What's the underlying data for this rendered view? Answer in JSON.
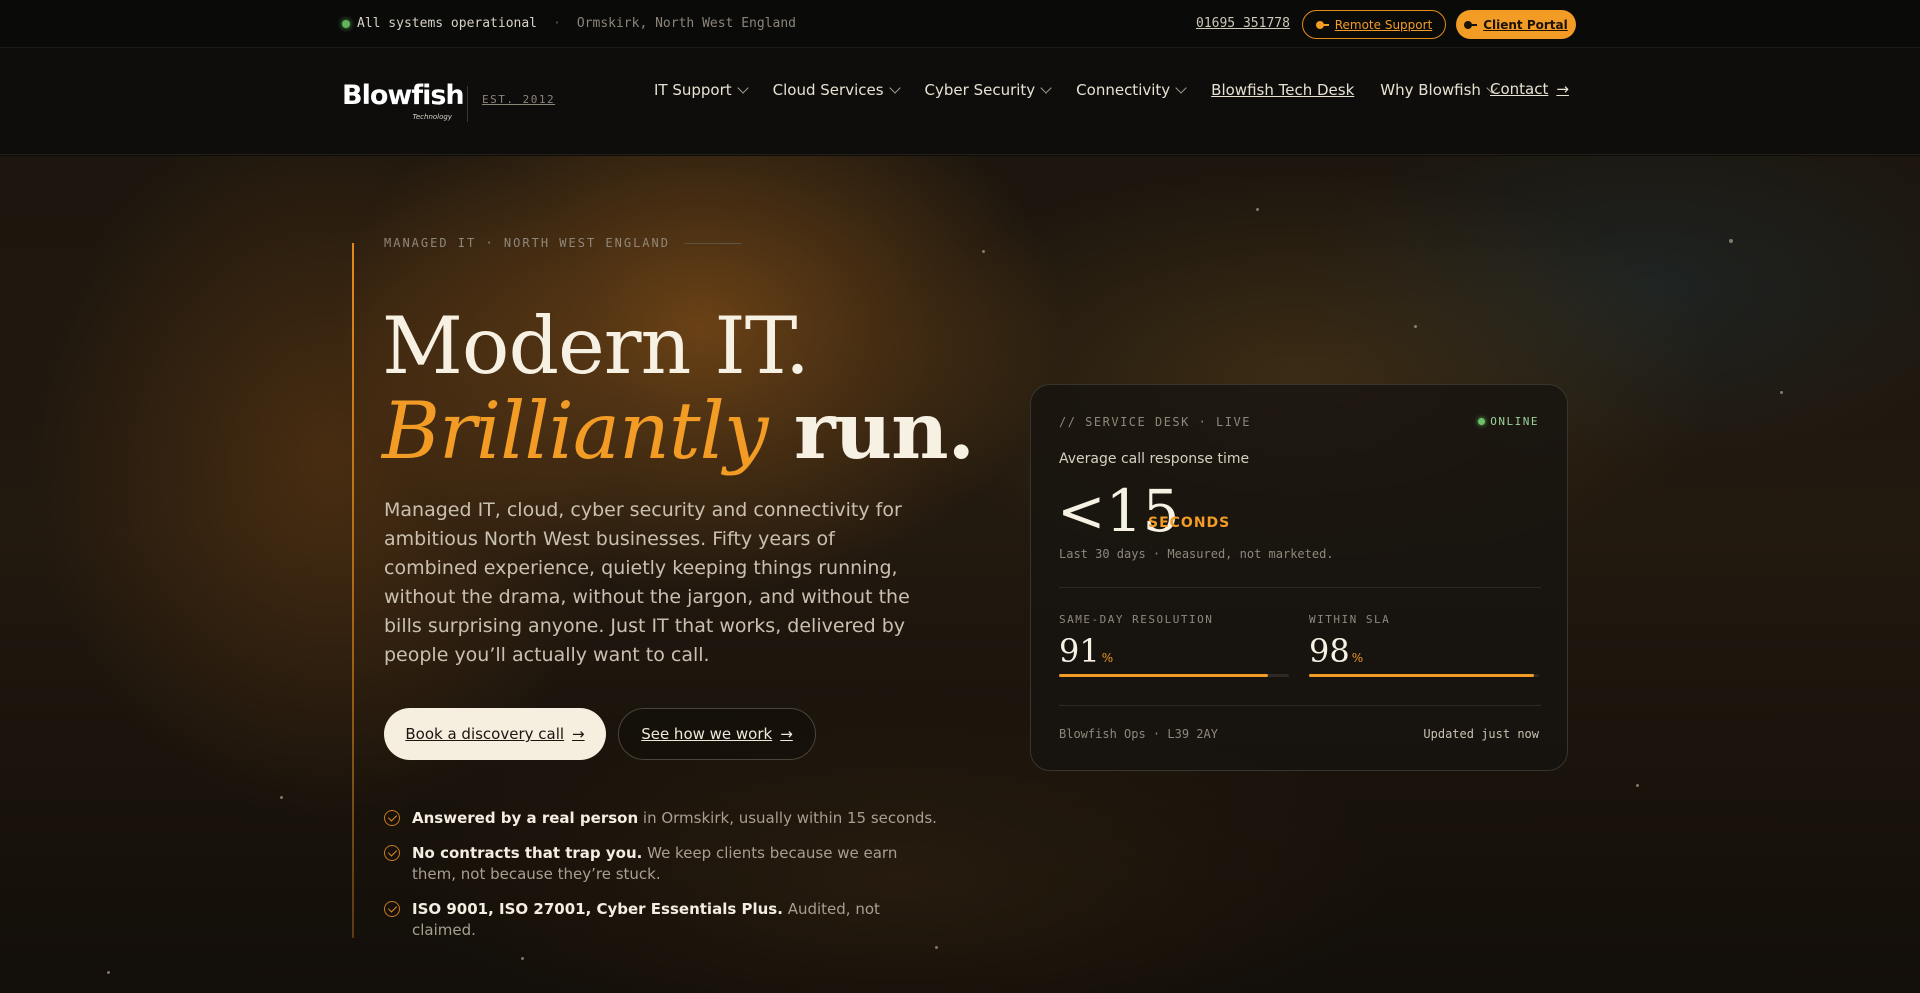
{
  "topbar": {
    "status_text": "All systems operational",
    "location": "Ormskirk, North West England",
    "phone": "01695 351778",
    "remote_support": "Remote Support",
    "client_portal": "Client Portal"
  },
  "nav": {
    "logo_text": "Blowfish",
    "logo_sub": "Technology",
    "est": "EST. 2012",
    "items": [
      {
        "label": "IT Support",
        "dropdown": true
      },
      {
        "label": "Cloud Services",
        "dropdown": true
      },
      {
        "label": "Cyber Security",
        "dropdown": true
      },
      {
        "label": "Connectivity",
        "dropdown": true
      },
      {
        "label": "Blowfish Tech Desk",
        "dropdown": false
      },
      {
        "label": "Why Blowfish",
        "dropdown": true
      }
    ],
    "contact": "Contact"
  },
  "hero": {
    "eyebrow": "MANAGED IT · NORTH WEST ENGLAND",
    "title_line1": "Modern IT.",
    "title_accent": "Brilliantly",
    "title_line2_rest": " run.",
    "intro": "Managed IT, cloud, cyber security and connectivity for ambitious North West businesses. Fifty years of combined experience, quietly keeping things running, without the drama, without the jargon, and without the bills surprising anyone. Just IT that works, delivered by people you’ll actually want to call.",
    "cta_primary": "Book a discovery call",
    "cta_secondary": "See how we work",
    "arrow": "→",
    "features": [
      {
        "bold": "Answered by a real person",
        "rest": " in Ormskirk, usually within 15 seconds."
      },
      {
        "bold": "No contracts that trap you.",
        "rest": " We keep clients because we earn them, not because they’re stuck."
      },
      {
        "bold": "ISO 9001, ISO 27001, Cyber Essentials Plus.",
        "rest": " Audited, not claimed."
      }
    ]
  },
  "card": {
    "header": "// SERVICE DESK · LIVE",
    "online": "ONLINE",
    "metric_label": "Average call response time",
    "metric_value": "<15",
    "metric_unit": "SECONDS",
    "metric_note": "Last 30 days · Measured, not marketed.",
    "stats": [
      {
        "label": "SAME-DAY RESOLUTION",
        "value": "91",
        "unit": "%",
        "fill": 0.91
      },
      {
        "label": "WITHIN SLA",
        "value": "98",
        "unit": "%",
        "fill": 0.98
      }
    ],
    "footer_left": "Blowfish Ops · L39 2AY",
    "footer_right": "Updated just now"
  },
  "colors": {
    "accent": "#f29b25",
    "status_green": "#5fb35a",
    "background": "#0d0b08"
  }
}
